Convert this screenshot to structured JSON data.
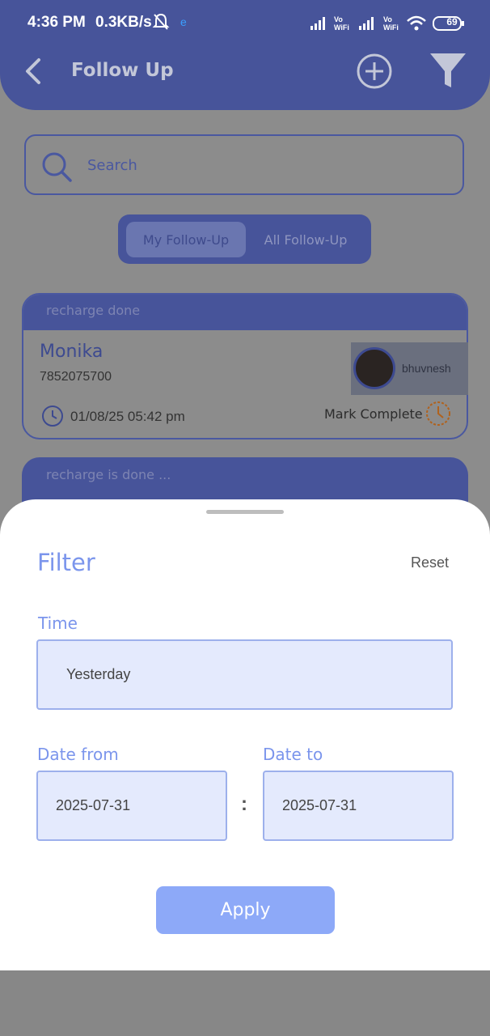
{
  "status_bar": {
    "time": "4:36 PM",
    "speed": "0.3KB/s",
    "indicator": "e",
    "battery": "69"
  },
  "header": {
    "title": "Follow Up",
    "back_icon": "chevron-left-icon",
    "add_icon": "plus-circle-icon",
    "filter_icon": "funnel-icon"
  },
  "search": {
    "placeholder": "Search"
  },
  "tabs": {
    "my": "My Follow-Up",
    "all": "All Follow-Up"
  },
  "cards": [
    {
      "status": "recharge done",
      "name": "Monika",
      "phone": "7852075700",
      "datetime": "01/08/25 05:42 pm",
      "assignee": "bhuvnesh",
      "action": "Mark Complete"
    },
    {
      "status": "recharge is done ..."
    }
  ],
  "filter": {
    "title": "Filter",
    "reset": "Reset",
    "time_label": "Time",
    "time_value": "Yesterday",
    "date_from_label": "Date from",
    "date_from_value": "2025-07-31",
    "separator": ":",
    "date_to_label": "Date to",
    "date_to_value": "2025-07-31",
    "apply": "Apply"
  },
  "colors": {
    "header_bg": "#47549a",
    "accent": "#7b95ec",
    "field_bg": "#e4eafd",
    "apply_bg": "#8da9f8"
  }
}
